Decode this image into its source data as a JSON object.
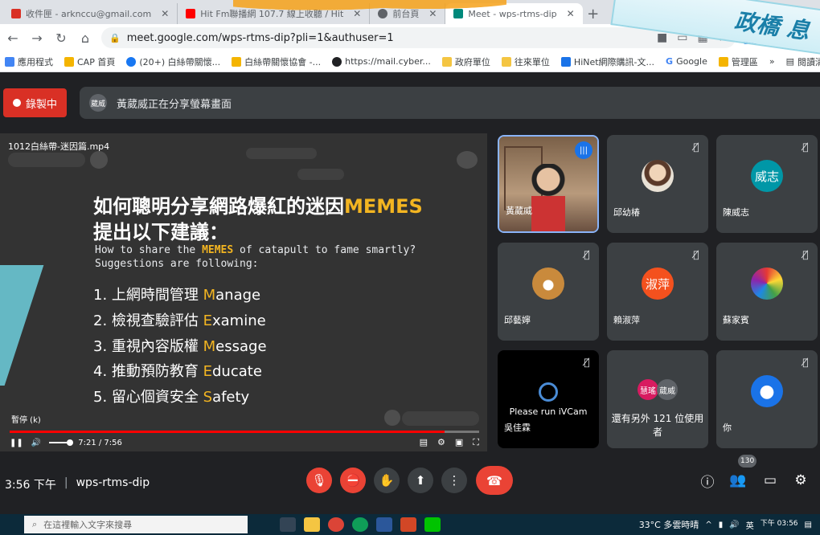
{
  "browser": {
    "tabs": [
      {
        "label": "收件匣 - arknccu@gmail.com",
        "color": "#d93025"
      },
      {
        "label": "Hit Fm聯播網 107.7 線上收聽 / Hit",
        "color": "#ff0000"
      },
      {
        "label": "前台頁",
        "color": "#5f6368"
      },
      {
        "label": "Meet - wps-rtms-dip",
        "color": "#00897b",
        "active": true
      }
    ],
    "new_tab": "+",
    "url": "meet.google.com/wps-rtms-dip?pli=1&authuser=1",
    "bookmarks": [
      {
        "label": "應用程式",
        "color": "#4285f4"
      },
      {
        "label": "CAP 首頁",
        "color": "#f4b400"
      },
      {
        "label": "(20+) 白絲帶關懷...",
        "color": "#1877f2"
      },
      {
        "label": "白絲帶關懷協會 -...",
        "color": "#f4b400"
      },
      {
        "label": "https://mail.cyber...",
        "color": "#202124"
      },
      {
        "label": "政府單位",
        "color": "#f4c542"
      },
      {
        "label": "往來單位",
        "color": "#f4c542"
      },
      {
        "label": "HiNet網際購訊-文...",
        "color": "#1a73e8"
      },
      {
        "label": "Google",
        "color": "#4285f4"
      },
      {
        "label": "管理區",
        "color": "#f4b400"
      }
    ],
    "bookmarks_more": "»",
    "reading_list": "閱讀清單"
  },
  "banner": {
    "text": "政橋 息"
  },
  "meet": {
    "recording_label": "錄製中",
    "presenter_avatar": "葳威",
    "presenting_message": "黃葳威正在分享螢幕畫面",
    "video": {
      "filename": "1012白絲帶-迷因篇.mp4",
      "title_line1_pre": "如何聰明分享網路爆紅的迷因",
      "title_line1_accent": "MEMES",
      "title_line2": "提出以下建議：",
      "sub_line1_pre": "How to share the ",
      "sub_line1_accent": "MEMES",
      "sub_line1_post": " of catapult to fame smartly?",
      "sub_line2": "Suggestions are following:",
      "items": [
        {
          "pre": "1. 上網時間管理 ",
          "accent": "M",
          "post": "anage"
        },
        {
          "pre": "2. 檢視查驗評估 ",
          "accent": "E",
          "post": "xamine"
        },
        {
          "pre": "3. 重視內容版權 ",
          "accent": "M",
          "post": "essage"
        },
        {
          "pre": "4. 推動預防教育 ",
          "accent": "E",
          "post": "ducate"
        },
        {
          "pre": "5. 留心個資安全 ",
          "accent": "S",
          "post": "afety"
        }
      ],
      "pause_label": "暫停 (k)",
      "time": "7:21 / 7:56",
      "progress": 0.926
    },
    "participants": [
      {
        "name": "黃葳威",
        "speaking": true
      },
      {
        "name": "邱幼椿",
        "muted": true
      },
      {
        "name": "陳威志",
        "muted": true,
        "initials": "威志",
        "color": "#0097a7"
      },
      {
        "name": "邱藝嬣",
        "muted": true
      },
      {
        "name": "賴淑萍",
        "muted": true,
        "initials": "淑萍",
        "color": "#f4511e"
      },
      {
        "name": "蘇家賓",
        "muted": true
      },
      {
        "name": "吳佳霖",
        "muted": true,
        "status": "Please run iVCam"
      },
      {
        "name": "還有另外 121 位使用者",
        "mini1": "慧瑤",
        "mini2": "葳威"
      },
      {
        "name": "你",
        "muted": true
      }
    ],
    "clock": "3:56 下午",
    "meeting_code": "wps-rtms-dip",
    "people_count": "130"
  },
  "taskbar": {
    "search_placeholder": "在這裡輸入文字來搜尋",
    "weather": "33°C 多雲時晴",
    "time": "下午 03:56",
    "lang": "英"
  }
}
